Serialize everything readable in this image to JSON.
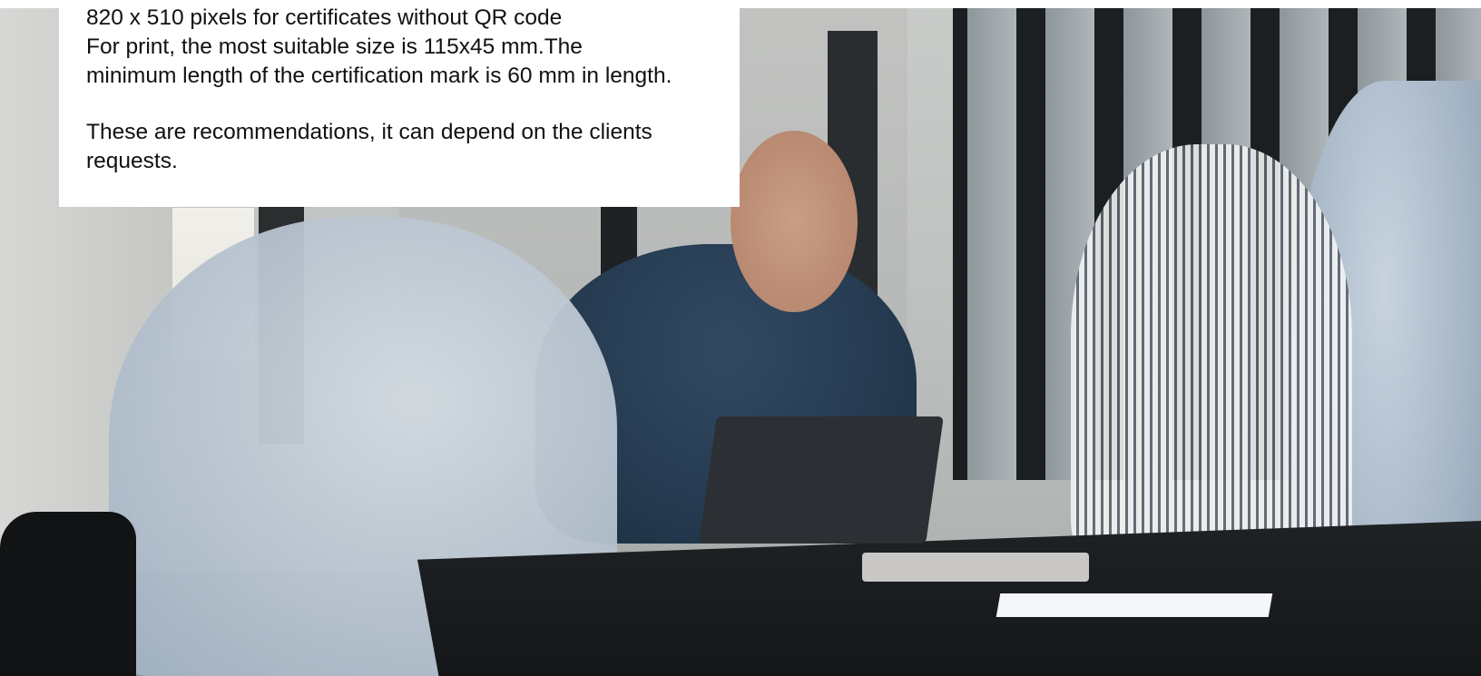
{
  "overlay": {
    "lines": [
      "820 x 510 pixels for certificates without QR code",
      "For print, the most suitable size is 115x45 mm.The",
      "minimum length of the certification mark is 60 mm in length."
    ],
    "note": "These are recommendations, it can depend on the clients requests."
  },
  "photo": {
    "description_icon": "meeting-photo"
  }
}
